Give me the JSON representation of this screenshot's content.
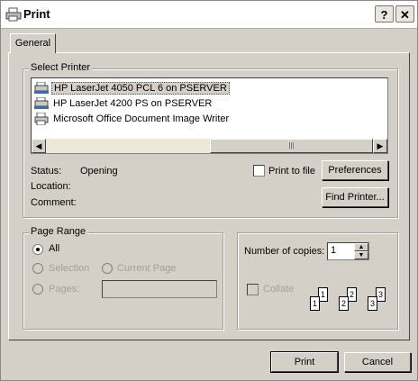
{
  "window": {
    "title": "Print",
    "help_label": "?",
    "close_label": "✕"
  },
  "tabs": [
    {
      "label": "General"
    }
  ],
  "select_printer": {
    "group_label": "Select Printer",
    "printers": [
      {
        "label": "HP LaserJet 4050 PCL 6 on PSERVER",
        "icon": "network-printer-icon",
        "selected": true
      },
      {
        "label": "HP LaserJet 4200 PS on PSERVER",
        "icon": "network-printer-icon"
      },
      {
        "label": "Microsoft Office Document Image Writer",
        "icon": "printer-icon"
      }
    ],
    "scroll_grip": "|||",
    "status_label": "Status:",
    "status_value": "Opening",
    "location_label": "Location:",
    "location_value": "",
    "comment_label": "Comment:",
    "comment_value": "",
    "print_to_file_label": "Print to file",
    "preferences_label": "Preferences",
    "find_printer_label": "Find Printer..."
  },
  "page_range": {
    "group_label": "Page Range",
    "all_label": "All",
    "selection_label": "Selection",
    "current_page_label": "Current Page",
    "pages_label": "Pages:",
    "pages_value": ""
  },
  "copies": {
    "label": "Number of copies:",
    "value": "1",
    "collate_label": "Collate",
    "page_numbers": [
      "1",
      "1",
      "2",
      "2",
      "3",
      "3"
    ]
  },
  "footer": {
    "print_label": "Print",
    "cancel_label": "Cancel"
  }
}
